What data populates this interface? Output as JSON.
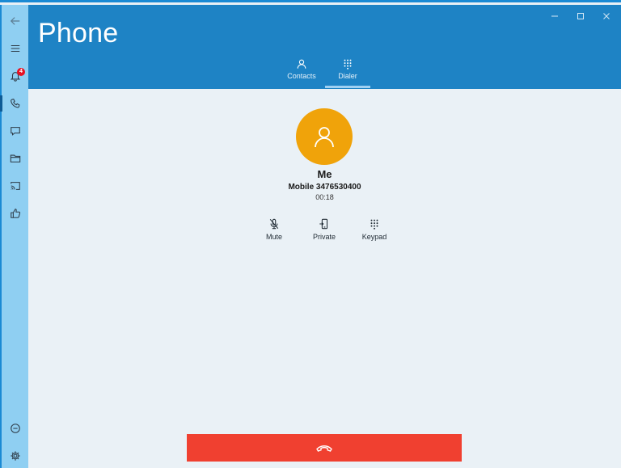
{
  "app": {
    "title": "Phone"
  },
  "sidebar": {
    "notification_count": "4",
    "items": [
      {
        "icon": "back-arrow-icon"
      },
      {
        "icon": "hamburger-menu-icon"
      },
      {
        "icon": "bell-icon"
      },
      {
        "icon": "phone-icon"
      },
      {
        "icon": "message-icon"
      },
      {
        "icon": "folder-icon"
      },
      {
        "icon": "cast-icon"
      },
      {
        "icon": "thumbs-up-icon"
      },
      {
        "icon": "minus-circle-icon"
      },
      {
        "icon": "gear-icon"
      }
    ]
  },
  "tabs": [
    {
      "label": "Contacts",
      "icon": "person-icon"
    },
    {
      "label": "Dialer",
      "icon": "keypad-icon",
      "selected": true
    }
  ],
  "call": {
    "name": "Me",
    "number": "Mobile 3476530400",
    "timer": "00:18"
  },
  "actions": [
    {
      "label": "Mute",
      "icon": "mic-off-icon"
    },
    {
      "label": "Private",
      "icon": "phone-device-icon"
    },
    {
      "label": "Keypad",
      "icon": "keypad-icon"
    }
  ],
  "colors": {
    "header": "#1e83c5",
    "sidebar": "#8fcff2",
    "avatar": "#f0a30a",
    "end_call": "#f04030",
    "badge": "#e81123"
  }
}
